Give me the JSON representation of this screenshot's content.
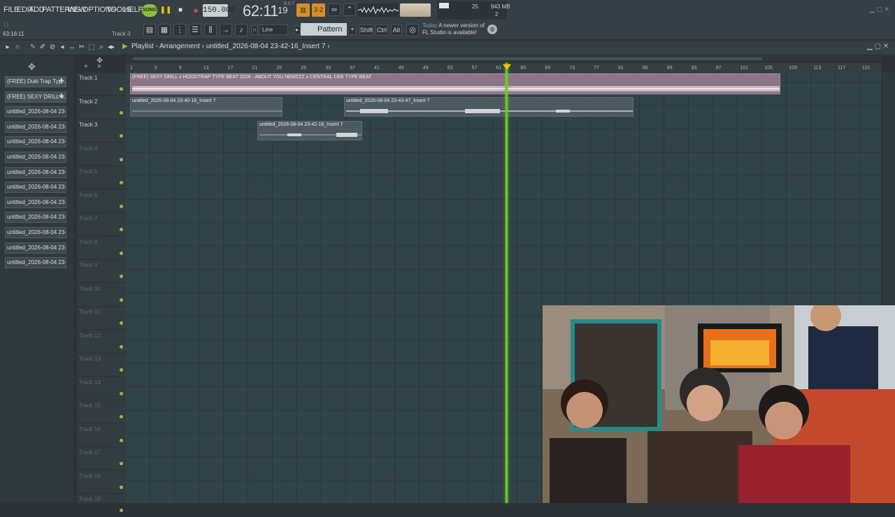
{
  "menu": [
    "FILE",
    "EDIT",
    "ADD",
    "PATTERNS",
    "VIEW",
    "OPTIONS",
    "TOOLS",
    "HELP"
  ],
  "toolbar": {
    "song_mode": "SONG",
    "tempo": "150.000",
    "time": "62:11",
    "time_sub": "19",
    "time_sub2": "B:S:T",
    "cpu_value": "25",
    "memory": "943 MB",
    "voices": "2"
  },
  "hint": {
    "position": "63:16:11",
    "track": "Track 3"
  },
  "snap": "Line",
  "pattern": "Pattern 1",
  "modifiers": [
    "Shift",
    "Ctrl",
    "Alt"
  ],
  "news": {
    "line1_label": "Today",
    "line1_text": "A newer version of",
    "line2_text": "FL Studio is available!"
  },
  "playlist": {
    "title": "Playlist - Arrangement",
    "path": "untitled_2026-08-04 23-42-16_Insert 7"
  },
  "browser_items": [
    "(FREE) Duki Trap Typ...",
    "(FREE) SEXY DRILL x...",
    "untitled_2026-08-04 23-...",
    "untitled_2026-08-04 23-...",
    "untitled_2026-08-04 23-...",
    "untitled_2026-08-04 23-...",
    "untitled_2026-08-04 23-...",
    "untitled_2026-08-04 23-...",
    "untitled_2026-08-04 23-...",
    "untitled_2026-08-04 23-...",
    "untitled_2026-08-04 23-...",
    "untitled_2026-08-04 23-...",
    "untitled_2026-08-04 23-..."
  ],
  "tracks": [
    "Track 1",
    "Track 2",
    "Track 3",
    "Track 4",
    "Track 5",
    "Track 6",
    "Track 7",
    "Track 8",
    "Track 9",
    "Track 10",
    "Track 11",
    "Track 12",
    "Track 13",
    "Track 14",
    "Track 15",
    "Track 16",
    "Track 17",
    "Track 18",
    "Track 19"
  ],
  "ruler": [
    "1",
    "5",
    "9",
    "13",
    "17",
    "21",
    "25",
    "29",
    "33",
    "37",
    "41",
    "45",
    "49",
    "53",
    "57",
    "61",
    "65",
    "69",
    "73",
    "77",
    "81",
    "85",
    "89",
    "93",
    "97",
    "101",
    "105",
    "109",
    "113",
    "117",
    "121"
  ],
  "clips": {
    "clip1": "(FREE) SEXY DRILL x HOODTRAP TYPE BEAT 2026 - ABOUT YOU  NEMZZZ x CENTRAL CEE TYPE BEAT",
    "clip2a": "untitled_2026-08-04 23-40-16_Insert 7",
    "clip2b": "untitled_2026-08-04 23-43-47_Insert 7",
    "clip3": "untitled_2026-08-04 23-42-16_Insert 7"
  },
  "colors": {
    "playhead": "#6ccc24",
    "clip1": "#8c7486",
    "accent_orange": "#d48f2c"
  }
}
